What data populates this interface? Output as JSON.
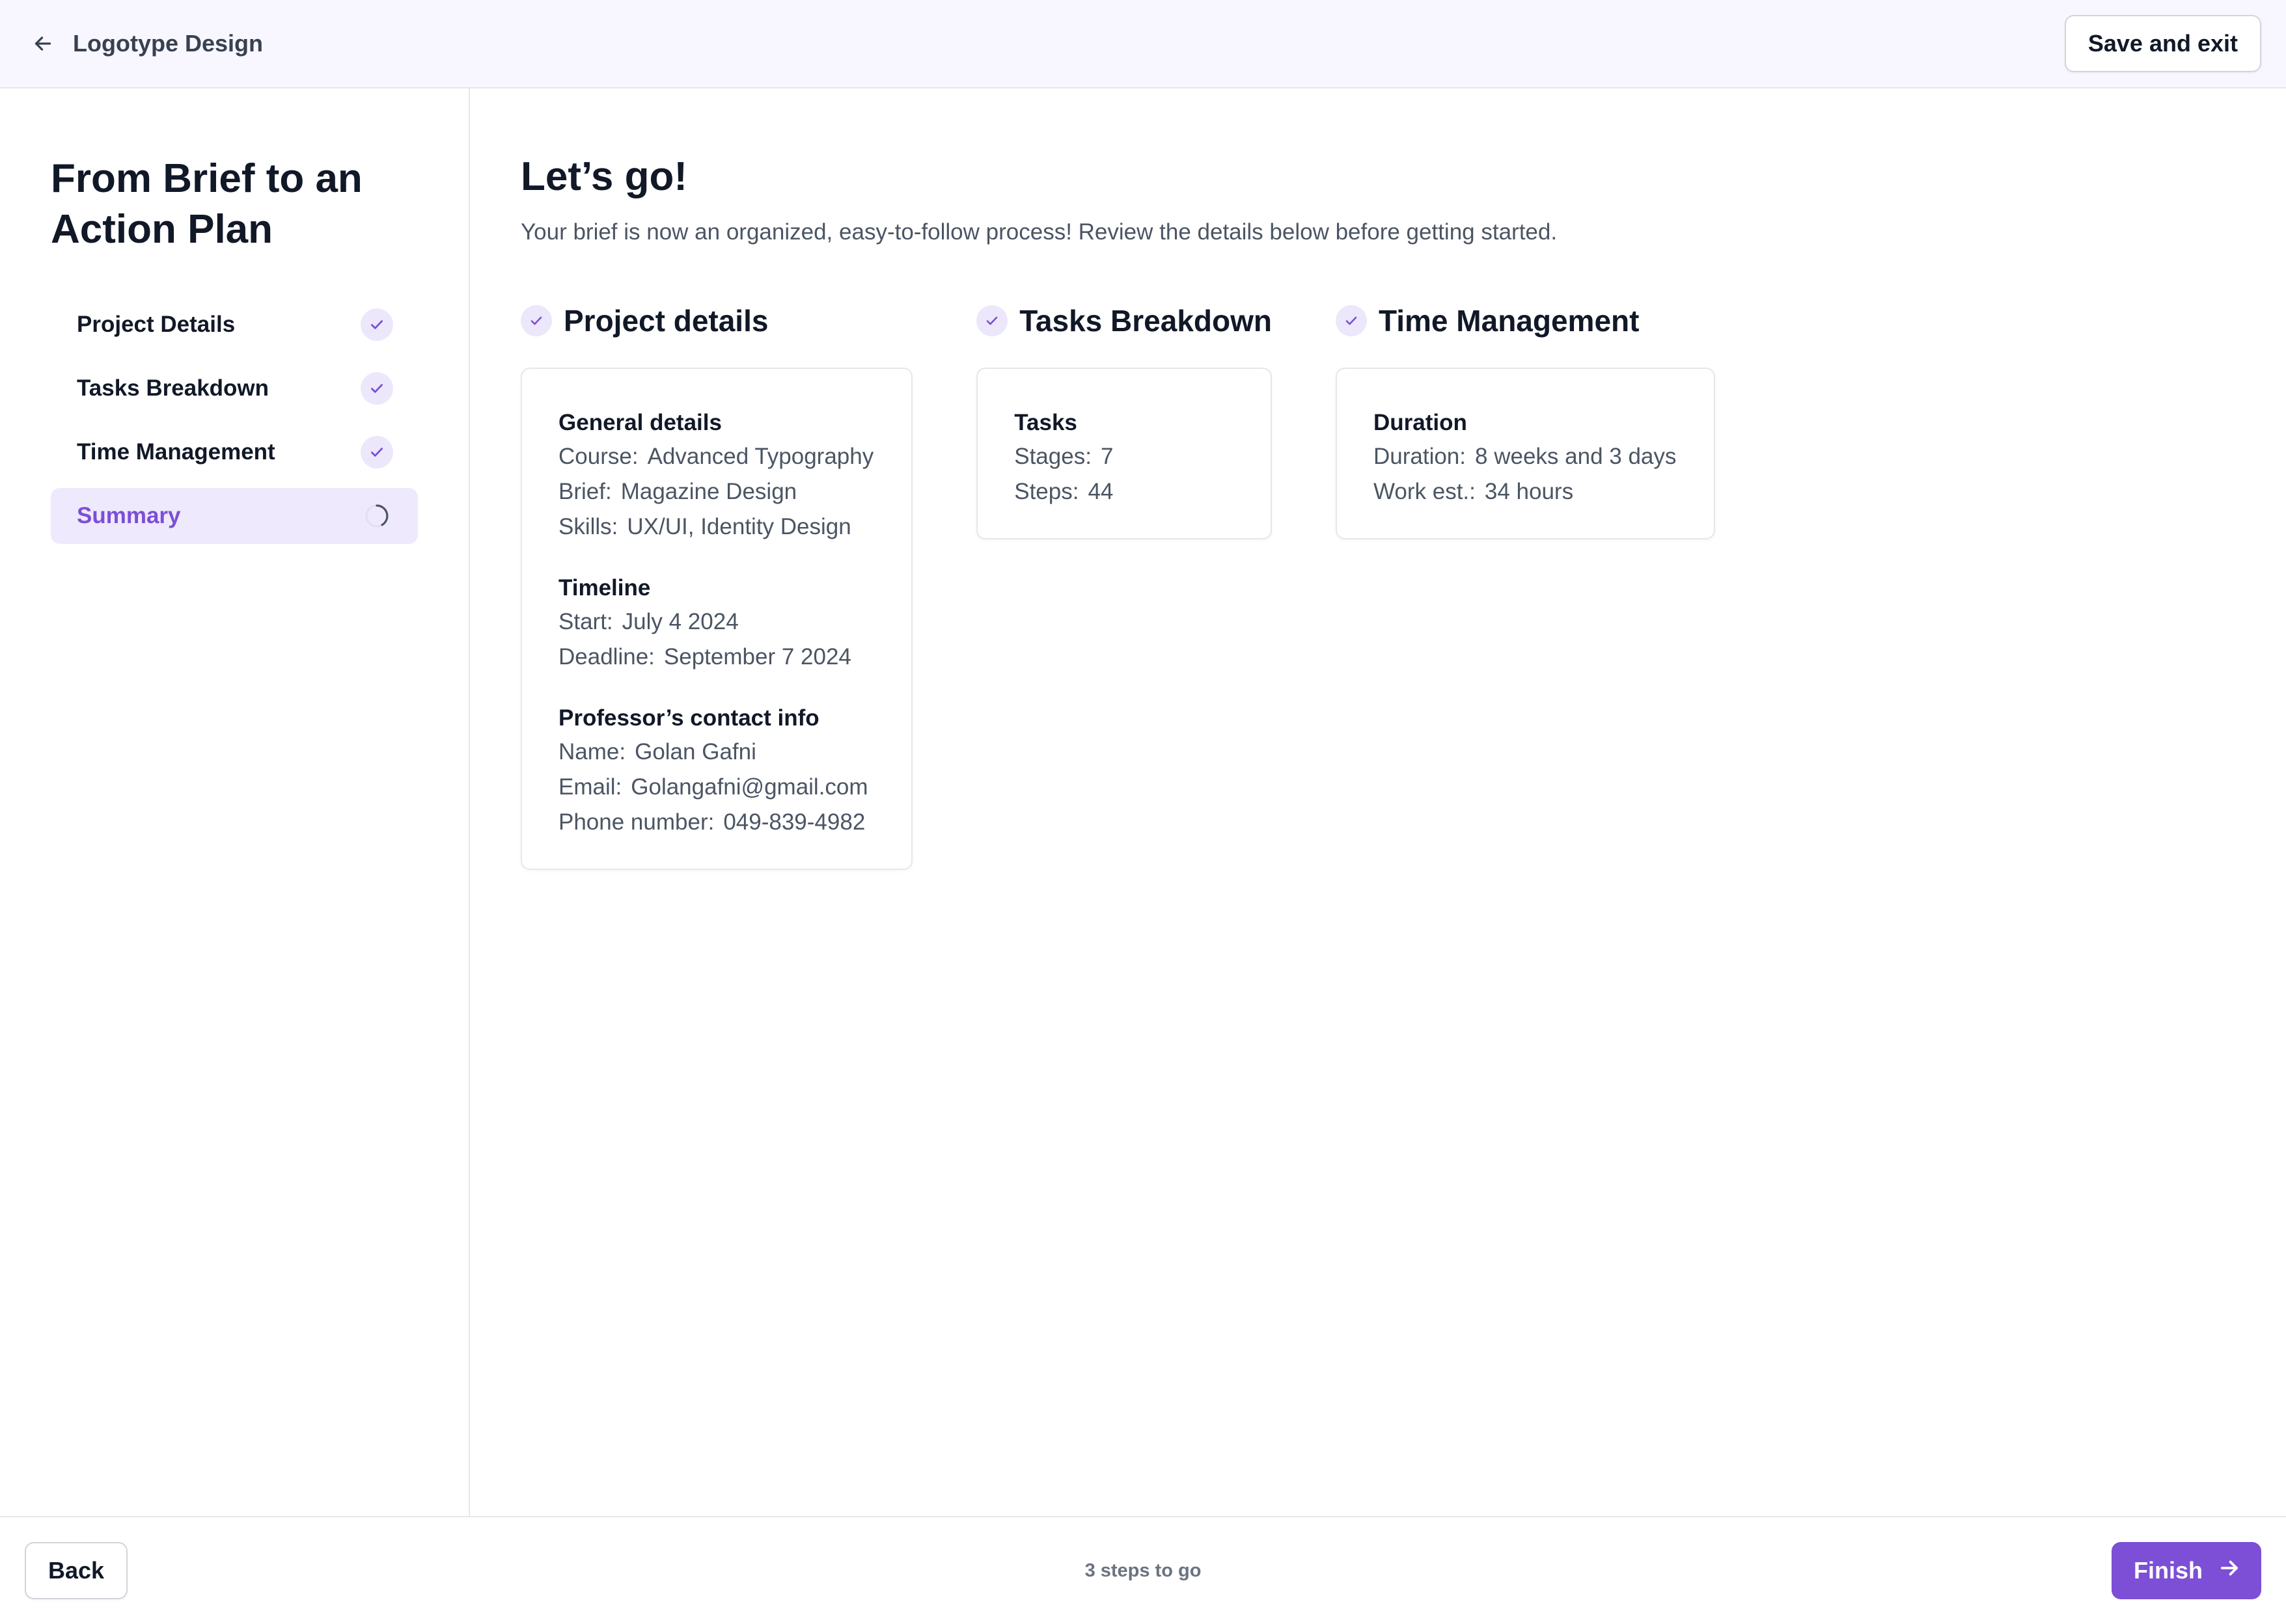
{
  "header": {
    "title": "Logotype Design",
    "save_exit_label": "Save and exit"
  },
  "sidebar": {
    "title": "From Brief to an Action Plan",
    "steps": [
      {
        "label": "Project Details",
        "status": "done"
      },
      {
        "label": "Tasks Breakdown",
        "status": "done"
      },
      {
        "label": "Time Management",
        "status": "done"
      },
      {
        "label": "Summary",
        "status": "in-progress"
      }
    ]
  },
  "main": {
    "title": "Let’s go!",
    "subtitle": "Your brief is now an organized, easy-to-follow process! Review the details below before getting started.",
    "project_details": {
      "heading": "Project details",
      "general": {
        "title": "General details",
        "rows": [
          {
            "label": "Course:",
            "value": "Advanced Typography"
          },
          {
            "label": "Brief:",
            "value": "Magazine Design"
          },
          {
            "label": "Skills:",
            "value": "UX/UI, Identity Design"
          }
        ]
      },
      "timeline": {
        "title": "Timeline",
        "rows": [
          {
            "label": "Start:",
            "value": "July 4 2024"
          },
          {
            "label": "Deadline:",
            "value": "September 7 2024"
          }
        ]
      },
      "contact": {
        "title": "Professor’s contact info",
        "rows": [
          {
            "label": "Name:",
            "value": "Golan Gafni"
          },
          {
            "label": "Email:",
            "value": "Golangafni@gmail.com"
          },
          {
            "label": "Phone number:",
            "value": "049-839-4982"
          }
        ]
      }
    },
    "tasks_breakdown": {
      "heading": "Tasks Breakdown",
      "tasks": {
        "title": "Tasks",
        "rows": [
          {
            "label": "Stages:",
            "value": "7"
          },
          {
            "label": "Steps:",
            "value": "44"
          }
        ]
      }
    },
    "time_management": {
      "heading": "Time Management",
      "duration": {
        "title": "Duration",
        "rows": [
          {
            "label": "Duration:",
            "value": "8 weeks and 3 days"
          },
          {
            "label": "Work est.:",
            "value": "34 hours"
          }
        ]
      }
    }
  },
  "footer": {
    "back_label": "Back",
    "progress_text": "3 steps to go",
    "finish_label": "Finish"
  },
  "colors": {
    "accent": "#7c4fd6",
    "accent_light": "#efe9fd",
    "header_bg": "#f8f6fe"
  }
}
